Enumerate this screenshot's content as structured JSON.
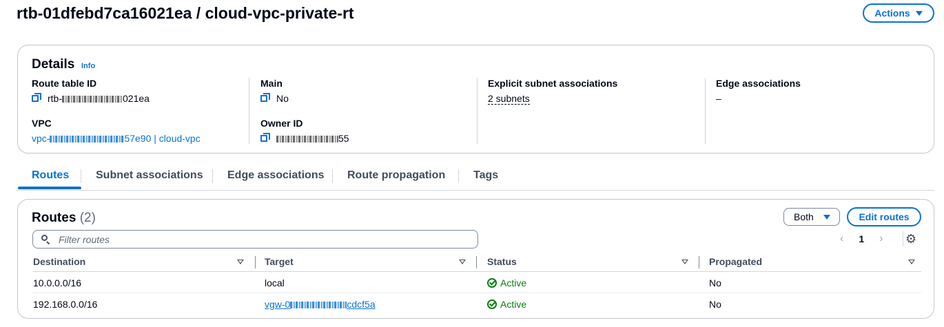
{
  "page": {
    "title": "rtb-01dfebd7ca16021ea / cloud-vpc-private-rt",
    "actions_label": "Actions"
  },
  "details": {
    "heading": "Details",
    "info_label": "Info",
    "route_table_id": {
      "label": "Route table ID",
      "prefix": "rtb-",
      "suffix": "021ea"
    },
    "vpc": {
      "label": "VPC",
      "prefix": "vpc-",
      "suffix": "57e90 | cloud-vpc"
    },
    "main": {
      "label": "Main",
      "value": "No"
    },
    "owner_id": {
      "label": "Owner ID",
      "suffix": "55"
    },
    "explicit_subnet": {
      "label": "Explicit subnet associations",
      "value": "2 subnets"
    },
    "edge_assoc": {
      "label": "Edge associations",
      "value": "–"
    }
  },
  "tabs": [
    {
      "label": "Routes",
      "active": true
    },
    {
      "label": "Subnet associations"
    },
    {
      "label": "Edge associations"
    },
    {
      "label": "Route propagation"
    },
    {
      "label": "Tags"
    }
  ],
  "routes": {
    "heading": "Routes",
    "count": "(2)",
    "filter_select": "Both",
    "edit_label": "Edit routes",
    "filter_placeholder": "Filter routes",
    "page_prev": "‹",
    "page": "1",
    "page_next": "›",
    "columns": [
      "Destination",
      "Target",
      "Status",
      "Propagated"
    ],
    "rows": [
      {
        "destination": "10.0.0.0/16",
        "target": "local",
        "status": "Active",
        "propagated": "No"
      },
      {
        "destination": "192.168.0.0/16",
        "target_prefix": "vgw-0",
        "target_suffix": "cdcf5a",
        "status": "Active",
        "propagated": "No"
      }
    ]
  },
  "colors": {
    "accent": "#0972d3",
    "success": "#037f0c",
    "text": "#000716",
    "border": "#c6c6cd"
  }
}
